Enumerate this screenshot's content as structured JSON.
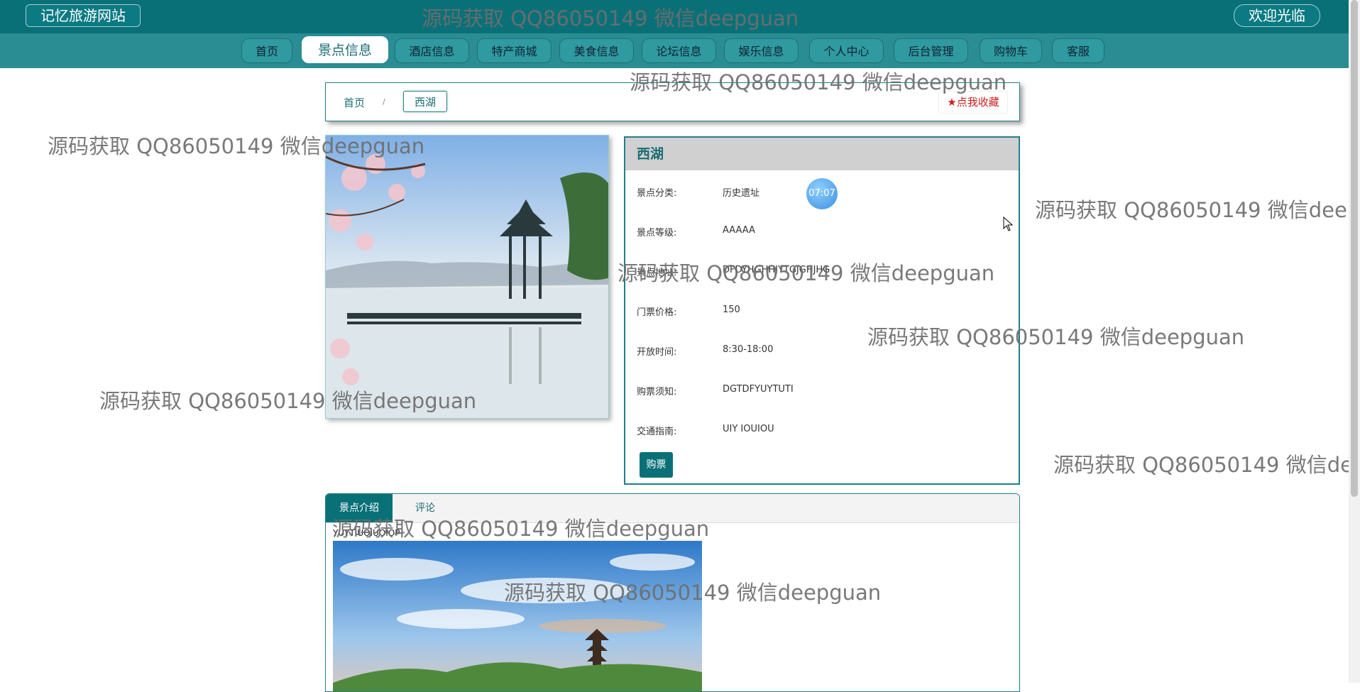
{
  "header": {
    "brand": "记忆旅游网站",
    "welcome": "欢迎光临"
  },
  "nav": {
    "items": [
      "首页",
      "景点信息",
      "酒店信息",
      "特产商城",
      "美食信息",
      "论坛信息",
      "娱乐信息",
      "个人中心",
      "后台管理",
      "购物车",
      "客服"
    ],
    "active": "景点信息"
  },
  "breadcrumb": {
    "home": "首页",
    "separator": "/",
    "current": "西湖"
  },
  "favorite": {
    "label": "★点我收藏"
  },
  "attraction": {
    "name": "西湖",
    "fields": [
      {
        "label": "景点分类:",
        "value": "历史遗址"
      },
      {
        "label": "景点等级:",
        "value": "AAAAA"
      },
      {
        "label": "景点地址:",
        "value": "DFDYHGHHJYTGJGHJHG"
      },
      {
        "label": "门票价格:",
        "value": "150"
      },
      {
        "label": "开放时间:",
        "value": "8:30-18:00"
      },
      {
        "label": "购票须知:",
        "value": "DGTDFYUYTUTI"
      },
      {
        "label": "交通指南:",
        "value": "UIY IOUIOU"
      }
    ],
    "buy_label": "购票",
    "timer": "07:07"
  },
  "tabs": {
    "items": [
      "景点介绍",
      "评论"
    ],
    "active": "景点介绍",
    "intro_text": "YUYTIUOIUOIOP"
  },
  "watermark": {
    "text": "源码获取 QQ86050149 微信deepguan"
  },
  "colors": {
    "primary": "#0a7078",
    "nav": "#2a8d93",
    "favorite": "#cc1f1f"
  }
}
